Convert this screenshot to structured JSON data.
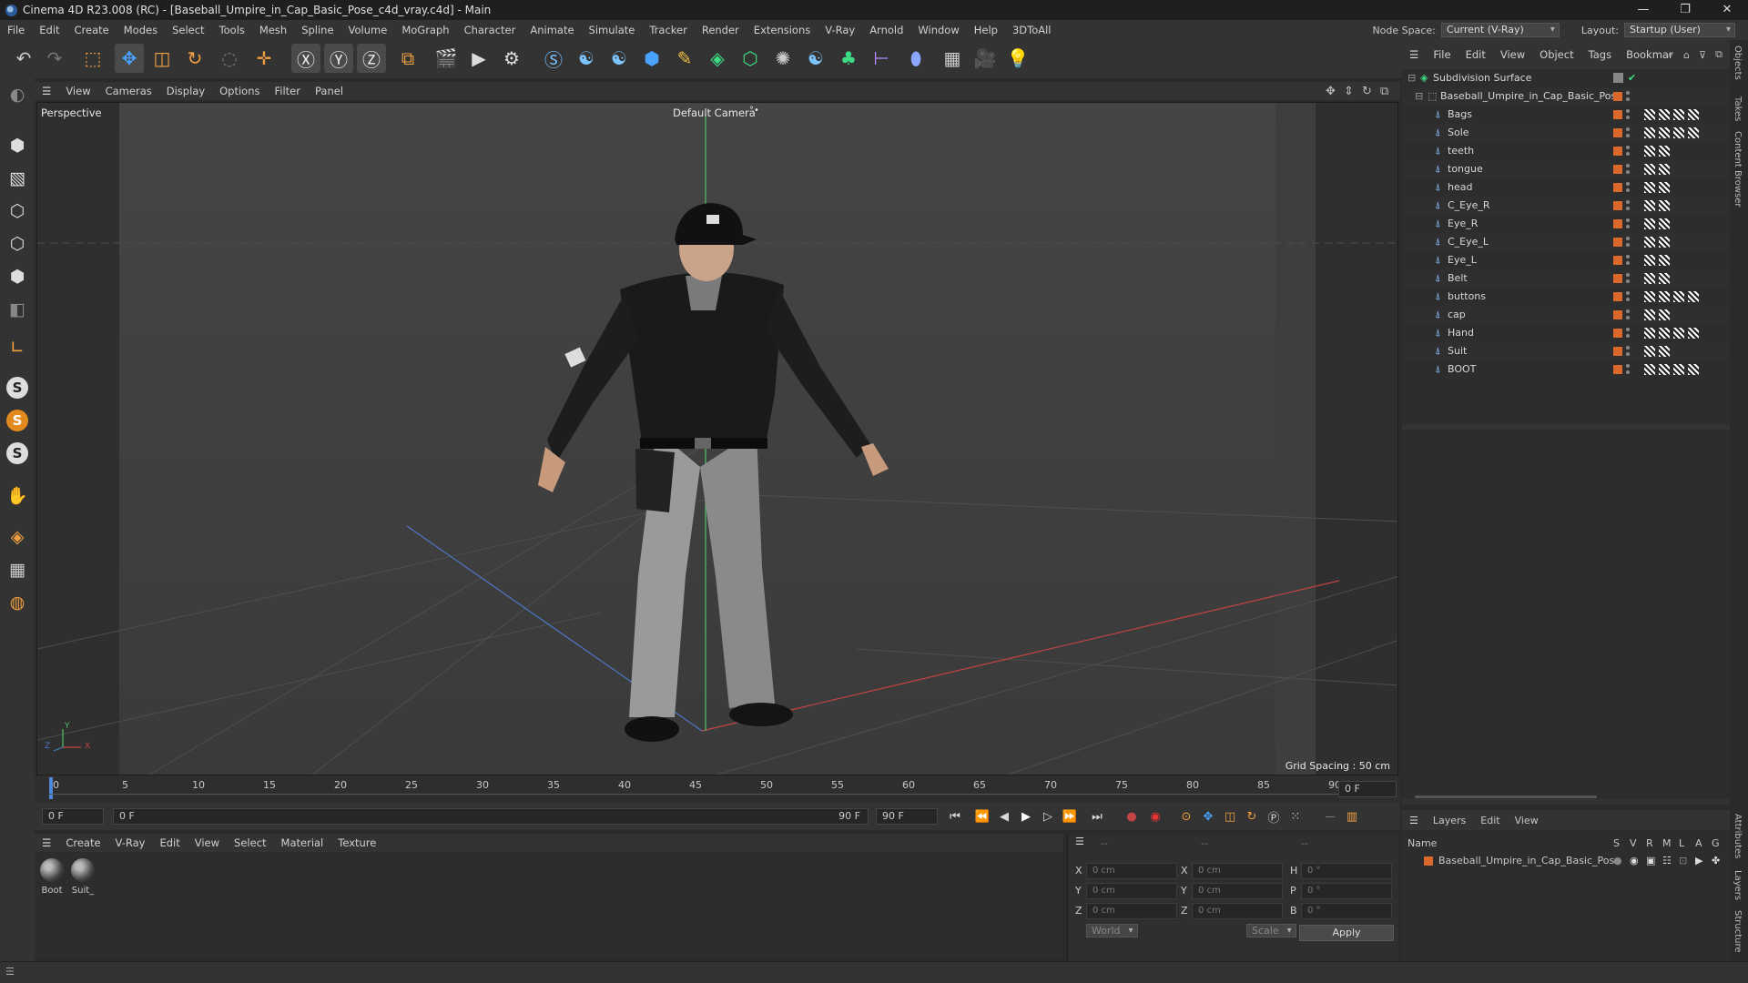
{
  "window": {
    "title": "Cinema 4D R23.008 (RC) - [Baseball_Umpire_in_Cap_Basic_Pose_c4d_vray.c4d] - Main",
    "controls": [
      "—",
      "❐",
      "✕"
    ]
  },
  "menubar": {
    "items": [
      "File",
      "Edit",
      "Create",
      "Modes",
      "Select",
      "Tools",
      "Mesh",
      "Spline",
      "Volume",
      "MoGraph",
      "Character",
      "Animate",
      "Simulate",
      "Tracker",
      "Render",
      "Extensions",
      "V-Ray",
      "Arnold",
      "Window",
      "Help",
      "3DToAll"
    ],
    "node_space_label": "Node Space:",
    "node_space_value": "Current (V-Ray)",
    "layout_label": "Layout:",
    "layout_value": "Startup (User)"
  },
  "viewport": {
    "menu": [
      "View",
      "Cameras",
      "Display",
      "Options",
      "Filter",
      "Panel"
    ],
    "view_name": "Perspective",
    "camera_name": "Default Camera",
    "camera_badge": "°•",
    "grid_spacing": "Grid Spacing : 50 cm",
    "axis_labels": {
      "x": "X",
      "y": "Y",
      "z": "Z"
    }
  },
  "timeline": {
    "ticks": [
      "0",
      "5",
      "10",
      "15",
      "20",
      "25",
      "30",
      "35",
      "40",
      "45",
      "50",
      "55",
      "60",
      "65",
      "70",
      "75",
      "80",
      "85",
      "90"
    ],
    "current_frame_right": "0 F"
  },
  "transport": {
    "start_frame": "0 F",
    "slider_start": "0 F",
    "slider_end": "90 F",
    "end_frame": "90 F"
  },
  "material_manager": {
    "menu": [
      "Create",
      "V-Ray",
      "Edit",
      "View",
      "Select",
      "Material",
      "Texture"
    ],
    "materials": [
      "Boot",
      "Suit_"
    ]
  },
  "coordinates": {
    "header_dashes": [
      "--",
      "--",
      "--"
    ],
    "rows": [
      {
        "pos_label": "X",
        "pos": "0 cm",
        "size_label": "X",
        "size": "0 cm",
        "rot_label": "H",
        "rot": "0 °"
      },
      {
        "pos_label": "Y",
        "pos": "0 cm",
        "size_label": "Y",
        "size": "0 cm",
        "rot_label": "P",
        "rot": "0 °"
      },
      {
        "pos_label": "Z",
        "pos": "0 cm",
        "size_label": "Z",
        "size": "0 cm",
        "rot_label": "B",
        "rot": "0 °"
      }
    ],
    "space_value": "World",
    "mode_value": "Scale",
    "apply_label": "Apply"
  },
  "object_manager": {
    "menu": [
      "File",
      "Edit",
      "View",
      "Object",
      "Tags",
      "Bookmar"
    ],
    "root": "Subdivision Surface",
    "group": "Baseball_Umpire_in_Cap_Basic_Pose",
    "objects": [
      "Bags",
      "Sole",
      "teeth",
      "tongue",
      "head",
      "C_Eye_R",
      "Eye_R",
      "C_Eye_L",
      "Eye_L",
      "Belt",
      "buttons",
      "cap",
      "Hand",
      "Suit",
      "BOOT"
    ]
  },
  "layer_manager": {
    "menu": [
      "Layers",
      "Edit",
      "View"
    ],
    "columns": [
      "Name",
      "S",
      "V",
      "R",
      "M",
      "L",
      "A",
      "G"
    ],
    "layers": [
      "Baseball_Umpire_in_Cap_Basic_Pose"
    ]
  },
  "side_tabs": [
    "Objects",
    "Takes",
    "Content Browser",
    "Attributes",
    "Layers",
    "Structure"
  ],
  "colors": {
    "accent_orange": "#d8692a",
    "axis_x": "#c24545",
    "axis_y": "#4fc26a",
    "axis_z": "#4c78c8"
  }
}
